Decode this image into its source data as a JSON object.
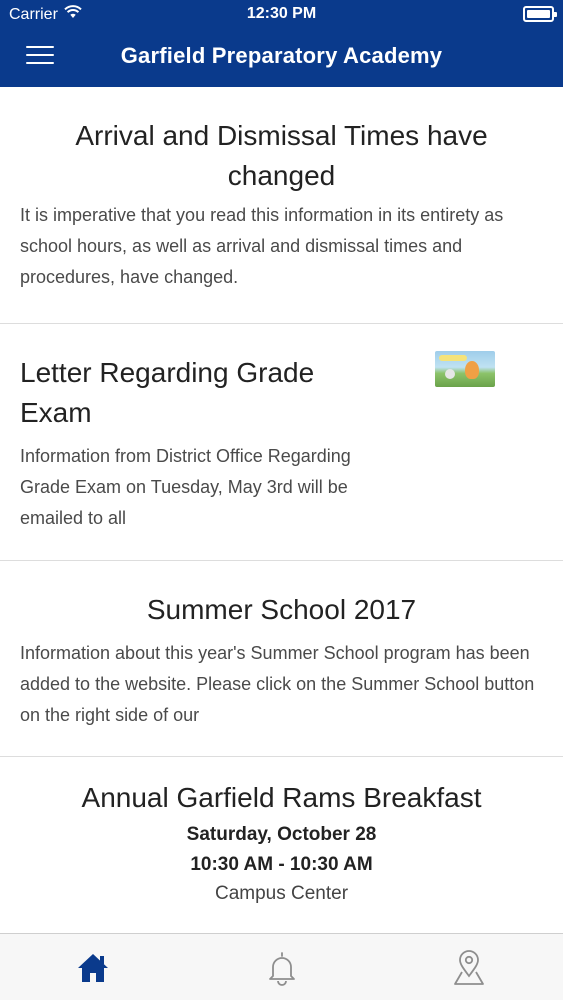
{
  "status_bar": {
    "carrier": "Carrier",
    "time": "12:30 PM"
  },
  "navbar": {
    "title": "Garfield Preparatory Academy"
  },
  "feed": [
    {
      "title": "Arrival and Dismissal Times have changed",
      "body": "It is imperative that you read this information in its entirety as school hours, as well as arrival and dismissal times and procedures, have changed."
    },
    {
      "title": "Letter Regarding Grade Exam",
      "body": "Information from District Office Regarding Grade Exam on Tuesday, May 3rd will be emailed to all"
    },
    {
      "title": "Summer School 2017",
      "body": "Information about this year's Summer School program has been added to the website. Please click on the Summer School button on the right side of our"
    },
    {
      "title": "Annual Garfield Rams Breakfast",
      "date": "Saturday, October 28",
      "time": "10:30 AM - 10:30 AM",
      "location": "Campus Center"
    }
  ],
  "tabbar": {
    "tabs": [
      {
        "icon": "home-icon",
        "active": true
      },
      {
        "icon": "bell-icon",
        "active": false
      },
      {
        "icon": "map-pin-icon",
        "active": false
      }
    ],
    "active_color": "#0a3a8c",
    "inactive_color": "#8e8e8e"
  },
  "colors": {
    "brand": "#0a3a8c"
  }
}
